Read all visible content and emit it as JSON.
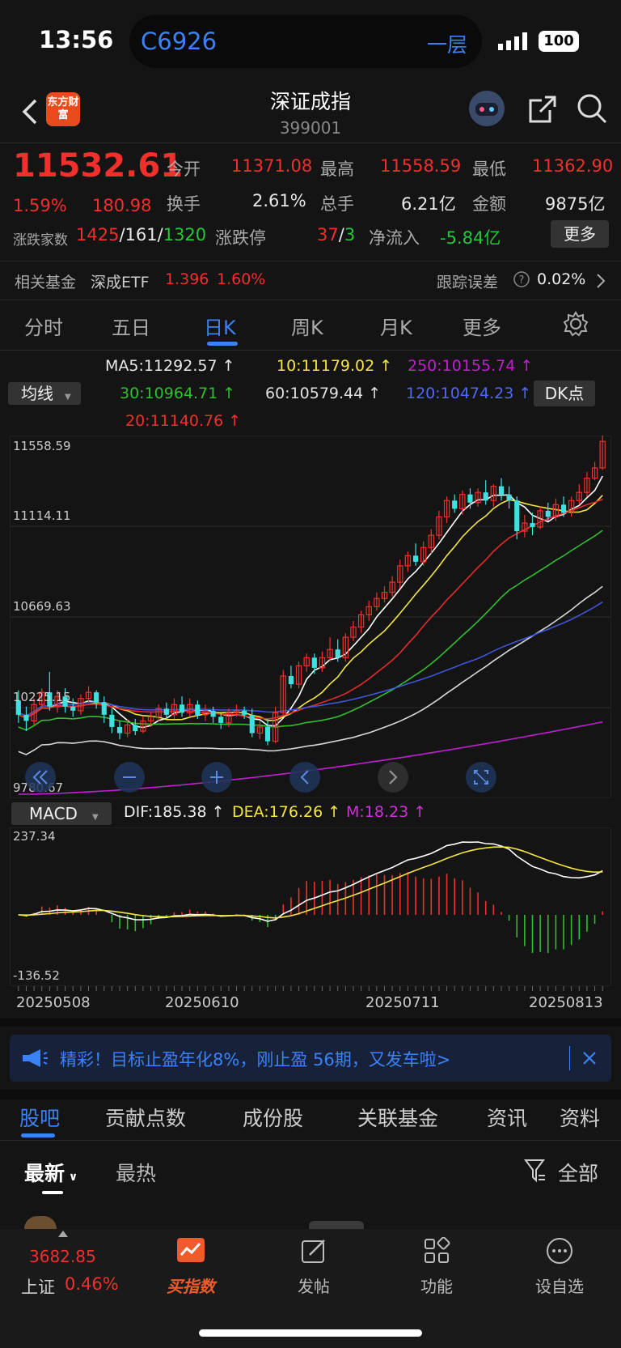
{
  "status_bar": {
    "time": "13:56",
    "island_code": "C6926",
    "floor": "一层",
    "battery": "100"
  },
  "header": {
    "logo_text": "东方财富",
    "title": "深证成指",
    "code": "399001"
  },
  "quote": {
    "price": "11532.61",
    "change_pct": "1.59%",
    "change": "180.98",
    "labels": {
      "open": "今开",
      "high": "最高",
      "low": "最低",
      "turnover_rate": "换手",
      "volume": "总手",
      "amount": "金额",
      "updown_count": "涨跌家数",
      "limit": "涨跌停",
      "net_inflow": "净流入"
    },
    "open": "11371.08",
    "high": "11558.59",
    "low": "11362.90",
    "turnover_rate": "2.61%",
    "volume": "6.21亿",
    "amount": "9875亿",
    "up": "1425",
    "flat": "161",
    "down": "1320",
    "limit_up": "37",
    "limit_down": "3",
    "net_inflow": "-5.84亿",
    "more_label": "更多"
  },
  "fund": {
    "label": "相关基金",
    "name": "深成ETF",
    "price": "1.396",
    "pct": "1.60%",
    "tracking_label": "跟踪误差",
    "tracking_value": "0.02%"
  },
  "chart_tabs": [
    "分时",
    "五日",
    "日K",
    "周K",
    "月K",
    "更多"
  ],
  "active_tab": "日K",
  "ma_panel": {
    "selector": "均线",
    "dk_label": "DK点",
    "ma5": "MA5:11292.57",
    "ma10": "10:11179.02",
    "ma250": "250:10155.74",
    "ma30": "30:10964.71",
    "ma60": "60:10579.44",
    "ma120": "120:10474.23",
    "ma20": "20:11140.76"
  },
  "chart_data": {
    "type": "candlestick",
    "y_ticks": [
      "11558.59",
      "11114.11",
      "10669.63",
      "10225.15",
      "9780.67"
    ],
    "ylim": [
      9780.67,
      11558.59
    ],
    "x_ticks": [
      "20250508",
      "20250610",
      "20250711",
      "20250813"
    ],
    "colors": {
      "up": "#f0302c",
      "down": "#3ee0e0",
      "ma5": "#ffffff",
      "ma10": "#f5e642",
      "ma20": "#e52b2b",
      "ma30": "#2fbf2f",
      "ma60": "#d8d8d8",
      "ma120": "#3f56d8",
      "ma250": "#c21fd0"
    },
    "candles": [
      [
        10260,
        10190,
        10310,
        10150
      ],
      [
        10190,
        10160,
        10230,
        10110
      ],
      [
        10160,
        10240,
        10270,
        10140
      ],
      [
        10240,
        10300,
        10320,
        10220
      ],
      [
        10300,
        10230,
        10400,
        10210
      ],
      [
        10230,
        10280,
        10310,
        10200
      ],
      [
        10280,
        10230,
        10320,
        10200
      ],
      [
        10230,
        10210,
        10270,
        10180
      ],
      [
        10210,
        10270,
        10290,
        10190
      ],
      [
        10270,
        10300,
        10330,
        10250
      ],
      [
        10300,
        10250,
        10310,
        10220
      ],
      [
        10250,
        10190,
        10280,
        10150
      ],
      [
        10190,
        10130,
        10220,
        10100
      ],
      [
        10130,
        10100,
        10160,
        10070
      ],
      [
        10100,
        10140,
        10170,
        10080
      ],
      [
        10140,
        10110,
        10170,
        10090
      ],
      [
        10110,
        10160,
        10180,
        10100
      ],
      [
        10160,
        10180,
        10200,
        10130
      ],
      [
        10180,
        10220,
        10240,
        10160
      ],
      [
        10220,
        10190,
        10250,
        10170
      ],
      [
        10190,
        10240,
        10270,
        10170
      ],
      [
        10240,
        10200,
        10280,
        10180
      ],
      [
        10200,
        10240,
        10270,
        10180
      ],
      [
        10240,
        10190,
        10260,
        10170
      ],
      [
        10190,
        10210,
        10240,
        10160
      ],
      [
        10210,
        10180,
        10230,
        10150
      ],
      [
        10180,
        10150,
        10200,
        10120
      ],
      [
        10150,
        10200,
        10220,
        10130
      ],
      [
        10200,
        10210,
        10240,
        10180
      ],
      [
        10210,
        10190,
        10230,
        10170
      ],
      [
        10190,
        10100,
        10220,
        10080
      ],
      [
        10100,
        10130,
        10160,
        10070
      ],
      [
        10130,
        10060,
        10170,
        10040
      ],
      [
        10060,
        10200,
        10230,
        10050
      ],
      [
        10200,
        10380,
        10410,
        10190
      ],
      [
        10380,
        10340,
        10430,
        10320
      ],
      [
        10340,
        10430,
        10450,
        10320
      ],
      [
        10430,
        10470,
        10490,
        10400
      ],
      [
        10470,
        10420,
        10490,
        10390
      ],
      [
        10420,
        10470,
        10500,
        10400
      ],
      [
        10470,
        10510,
        10570,
        10450
      ],
      [
        10510,
        10470,
        10560,
        10450
      ],
      [
        10470,
        10570,
        10590,
        10450
      ],
      [
        10570,
        10620,
        10650,
        10550
      ],
      [
        10620,
        10680,
        10700,
        10590
      ],
      [
        10680,
        10720,
        10750,
        10650
      ],
      [
        10720,
        10760,
        10790,
        10700
      ],
      [
        10760,
        10790,
        10820,
        10740
      ],
      [
        10790,
        10840,
        10870,
        10770
      ],
      [
        10840,
        10920,
        10950,
        10810
      ],
      [
        10920,
        10970,
        10990,
        10890
      ],
      [
        10970,
        10940,
        11030,
        10920
      ],
      [
        10940,
        11010,
        11040,
        10920
      ],
      [
        11010,
        11070,
        11100,
        10980
      ],
      [
        11070,
        11160,
        11190,
        11050
      ],
      [
        11160,
        11240,
        11260,
        11130
      ],
      [
        11240,
        11200,
        11270,
        11180
      ],
      [
        11200,
        11270,
        11290,
        11170
      ],
      [
        11270,
        11230,
        11300,
        11200
      ],
      [
        11230,
        11280,
        11300,
        11210
      ],
      [
        11280,
        11240,
        11340,
        11220
      ],
      [
        11240,
        11310,
        11320,
        11210
      ],
      [
        11310,
        11270,
        11350,
        11240
      ],
      [
        11270,
        11240,
        11310,
        11200
      ],
      [
        11240,
        11090,
        11260,
        11050
      ],
      [
        11090,
        11130,
        11170,
        11060
      ],
      [
        11130,
        11110,
        11180,
        11070
      ],
      [
        11110,
        11190,
        11210,
        11100
      ],
      [
        11190,
        11160,
        11230,
        11140
      ],
      [
        11160,
        11220,
        11250,
        11140
      ],
      [
        11220,
        11180,
        11260,
        11160
      ],
      [
        11180,
        11240,
        11260,
        11160
      ],
      [
        11240,
        11280,
        11320,
        11220
      ],
      [
        11280,
        11350,
        11380,
        11260
      ],
      [
        11350,
        11400,
        11430,
        11340
      ],
      [
        11400,
        11530,
        11560,
        11390
      ]
    ],
    "macd": {
      "labels": [
        "MACD",
        "DIF:185.38",
        "DEA:176.26",
        "M:18.23"
      ],
      "top": "237.34",
      "bottom": "-136.52"
    }
  },
  "banner": {
    "text": "精彩！目标止盈年化8%，刚止盈 56期，又发车啦>"
  },
  "bottom_tabs": [
    "股吧",
    "贡献点数",
    "成份股",
    "关联基金",
    "资讯",
    "资料"
  ],
  "sub_tabs": {
    "latest": "最新",
    "hot": "最热",
    "filter": "全部"
  },
  "bottom_nav": {
    "index_price": "3682.85",
    "index_name": "上证",
    "index_pct": "0.46%",
    "items": [
      "买指数",
      "发帖",
      "功能",
      "设自选"
    ]
  }
}
